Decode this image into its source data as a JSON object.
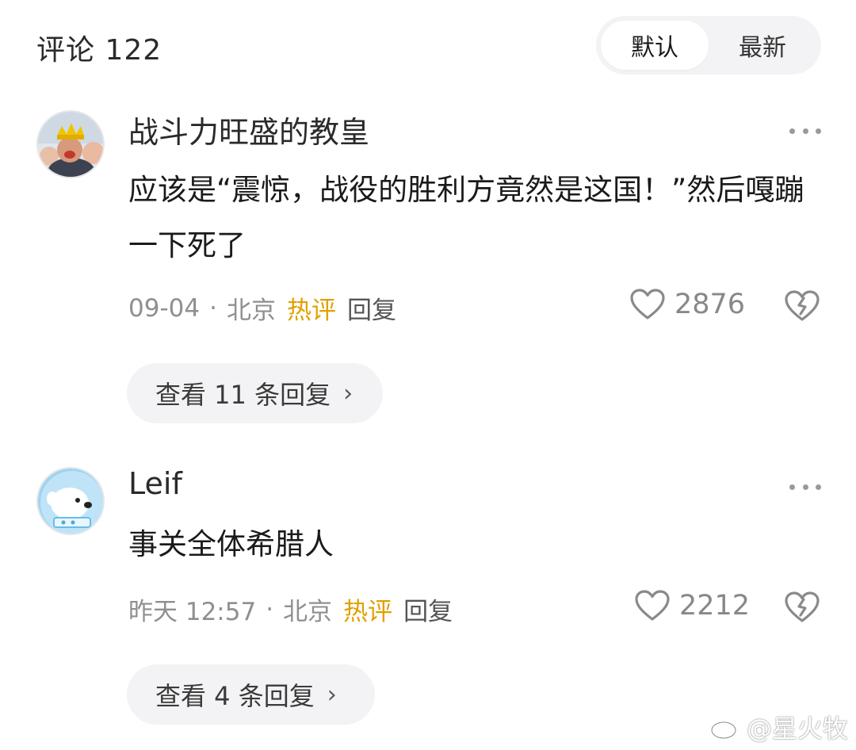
{
  "header": {
    "title": "评论 122",
    "sort_default": "默认",
    "sort_latest": "最新"
  },
  "comments": [
    {
      "username": "战斗力旺盛的教皇",
      "text": "应该是“震惊，战役的胜利方竟然是这国！”然后嘎蹦一下死了",
      "date": "09-04",
      "location": "北京",
      "hot_label": "热评",
      "reply_label": "回复",
      "likes": "2876",
      "view_replies": "查看 11 条回复"
    },
    {
      "username": "Leif",
      "text": "事关全体希腊人",
      "date": "昨天 12:57",
      "location": "北京",
      "hot_label": "热评",
      "reply_label": "回复",
      "likes": "2212",
      "view_replies": "查看 4 条回复"
    }
  ],
  "watermark": "@星火牧",
  "colors": {
    "accent_hot": "#e0a100",
    "meta_gray": "#8f8f8f",
    "pill_bg": "#f3f3f5"
  },
  "icons": [
    "heart-icon",
    "broken-heart-icon",
    "more-dots-icon",
    "chevron-right-icon",
    "weibo-logo-icon"
  ]
}
